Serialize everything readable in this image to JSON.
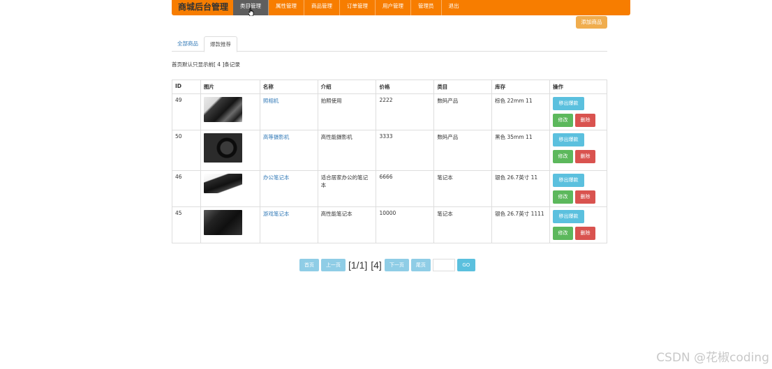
{
  "brand": "商城后台管理",
  "nav": [
    "类目管理",
    "属性管理",
    "商品管理",
    "订单管理",
    "用户管理",
    "管理员",
    "退出"
  ],
  "add_button": "添加商品",
  "tabs": [
    "全部商品",
    "爆款推荐"
  ],
  "notice": "首页默认只显示前[ 4 ]条记录",
  "table": {
    "headers": [
      "ID",
      "图片",
      "名称",
      "介绍",
      "价格",
      "类目",
      "库存",
      "操作"
    ],
    "rows": [
      {
        "id": "49",
        "name": "照相机",
        "intro": "拍照使用",
        "price": "2222",
        "category": "数码产品",
        "stock": "棕色 22mm 11",
        "thumb": "camera-image"
      },
      {
        "id": "50",
        "name": "高等摄影机",
        "intro": "高性能摄影机",
        "price": "3333",
        "category": "数码产品",
        "stock": "黑色 35mm 11",
        "thumb": "camera-image"
      },
      {
        "id": "46",
        "name": "办公笔记本",
        "intro": "适合居家办公的笔记本",
        "price": "6666",
        "category": "笔记本",
        "stock": "银色 26.7英寸 11",
        "thumb": "laptop-image"
      },
      {
        "id": "45",
        "name": "游戏笔记本",
        "intro": "高性能笔记本",
        "price": "10000",
        "category": "笔记本",
        "stock": "银色 26.7英寸 1111",
        "thumb": "laptop-image"
      }
    ],
    "actions": {
      "remove_hot": "移出爆款",
      "edit": "修改",
      "delete": "删除"
    }
  },
  "pager": {
    "first": "首页",
    "prev": "上一页",
    "page_info": "[1/1]",
    "total": "[4]",
    "next": "下一页",
    "last": "尾页",
    "go": "GO"
  },
  "watermark": "CSDN @花椒coding",
  "colors": {
    "nav": "#f77d00",
    "active_nav": "#5e5e5e",
    "add": "#f0ad4e",
    "info": "#5bc0de",
    "success": "#5cb85c",
    "danger": "#d9534f"
  }
}
